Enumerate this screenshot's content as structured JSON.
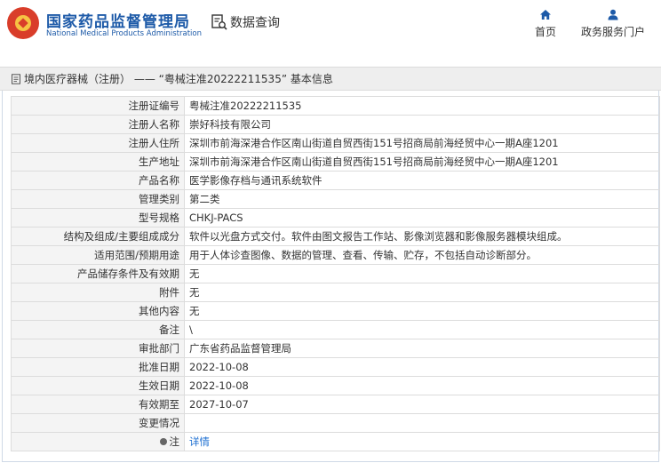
{
  "header": {
    "site_title_cn": "国家药品监督管理局",
    "site_title_en": "National Medical Products Administration",
    "query_title": "数据查询",
    "nav": [
      {
        "label": "首页",
        "icon": "home-icon"
      },
      {
        "label": "政务服务门户",
        "icon": "user-icon"
      }
    ]
  },
  "breadcrumb": {
    "text": "境内医疗器械（注册） —— “粤械注准20222211535” 基本信息"
  },
  "record": {
    "rows": [
      {
        "label": "注册证编号",
        "value": "粤械注准20222211535"
      },
      {
        "label": "注册人名称",
        "value": "崇好科技有限公司"
      },
      {
        "label": "注册人住所",
        "value": "深圳市前海深港合作区南山街道自贸西街151号招商局前海经贸中心一期A座1201"
      },
      {
        "label": "生产地址",
        "value": "深圳市前海深港合作区南山街道自贸西街151号招商局前海经贸中心一期A座1201"
      },
      {
        "label": "产品名称",
        "value": "医学影像存档与通讯系统软件"
      },
      {
        "label": "管理类别",
        "value": "第二类"
      },
      {
        "label": "型号规格",
        "value": "CHKJ-PACS"
      },
      {
        "label": "结构及组成/主要组成成分",
        "value": "软件以光盘方式交付。软件由图文报告工作站、影像浏览器和影像服务器模块组成。"
      },
      {
        "label": "适用范围/预期用途",
        "value": "用于人体诊查图像、数据的管理、查看、传输、贮存，不包括自动诊断部分。"
      },
      {
        "label": "产品储存条件及有效期",
        "value": "无"
      },
      {
        "label": "附件",
        "value": "无"
      },
      {
        "label": "其他内容",
        "value": "无"
      },
      {
        "label": "备注",
        "value": "\\"
      },
      {
        "label": "审批部门",
        "value": "广东省药品监督管理局"
      },
      {
        "label": "批准日期",
        "value": "2022-10-08"
      },
      {
        "label": "生效日期",
        "value": "2022-10-08"
      },
      {
        "label": "有效期至",
        "value": "2027-10-07"
      },
      {
        "label": "变更情况",
        "value": ""
      }
    ],
    "note_label": "注",
    "note_link": "详情"
  }
}
